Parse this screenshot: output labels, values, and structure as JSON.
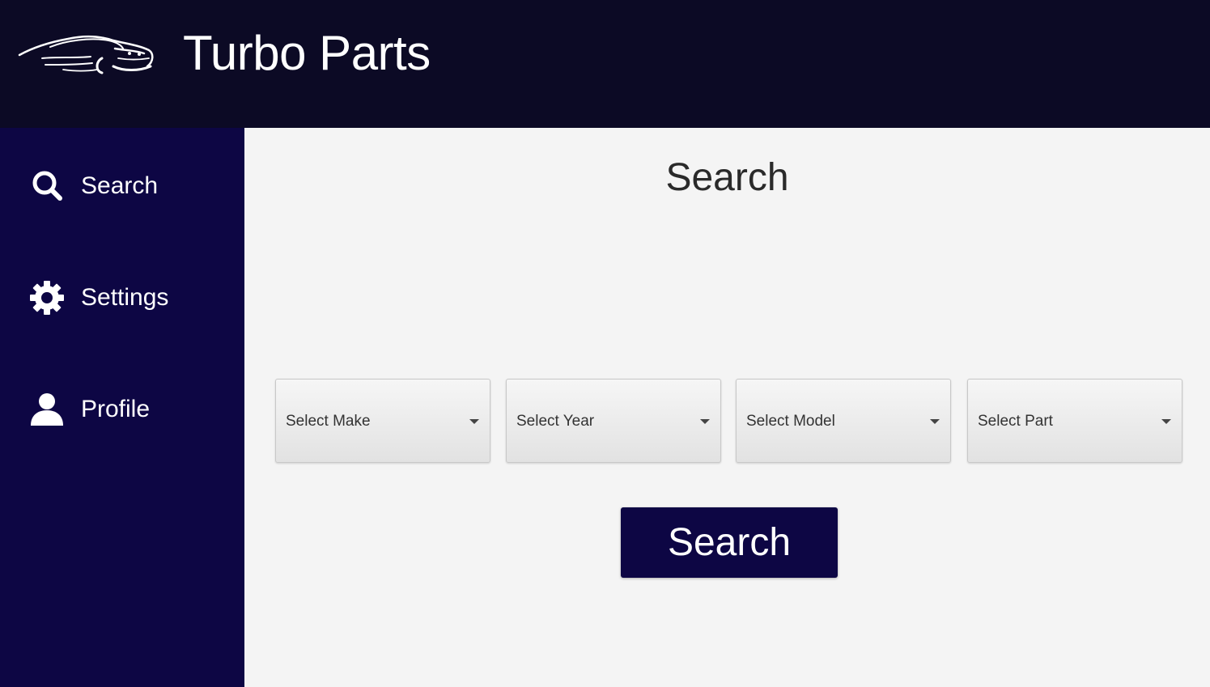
{
  "app": {
    "title": "Turbo Parts",
    "logo_icon": "car-logo-icon"
  },
  "colors": {
    "header_bg": "#0c0a25",
    "sidebar_bg": "#0d0644",
    "main_bg": "#f4f4f4",
    "button_bg": "#0d0644"
  },
  "sidebar": {
    "items": [
      {
        "label": "Search",
        "icon": "search-icon"
      },
      {
        "label": "Settings",
        "icon": "gear-icon"
      },
      {
        "label": "Profile",
        "icon": "user-icon"
      }
    ]
  },
  "main": {
    "title": "Search",
    "dropdowns": [
      {
        "label": "Select Make"
      },
      {
        "label": "Select Year"
      },
      {
        "label": "Select Model"
      },
      {
        "label": "Select Part"
      }
    ],
    "search_button_label": "Search"
  }
}
